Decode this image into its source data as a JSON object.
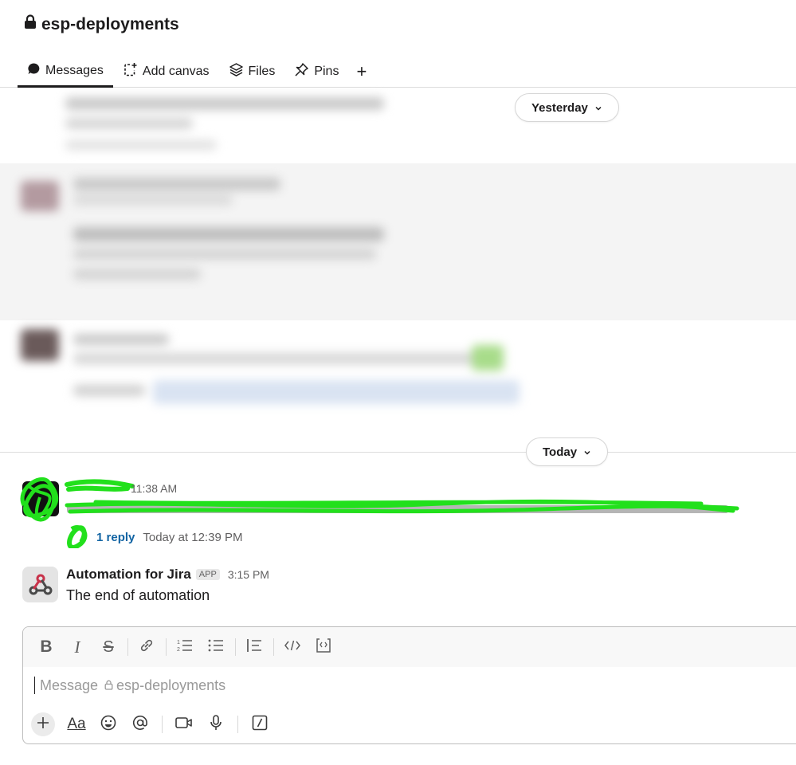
{
  "channel": {
    "name": "esp-deployments",
    "lock_icon": "lock-icon"
  },
  "tabs": [
    {
      "label": "Messages",
      "icon": "message-bubble-icon",
      "active": true
    },
    {
      "label": "Add canvas",
      "icon": "add-canvas-icon",
      "active": false
    },
    {
      "label": "Files",
      "icon": "layers-icon",
      "active": false
    },
    {
      "label": "Pins",
      "icon": "pin-icon",
      "active": false
    }
  ],
  "add_tab_label": "+",
  "date_dividers": {
    "yesterday": "Yesterday",
    "today": "Today"
  },
  "messages": {
    "first": {
      "time": "11:38 AM",
      "thread": {
        "reply_count": "1 reply",
        "last_reply": "Today at 12:39 PM"
      }
    },
    "second": {
      "author": "Automation for Jira",
      "badge": "APP",
      "time": "3:15 PM",
      "text": "The end of automation",
      "avatar_icon": "jira-automation-webhook-icon"
    }
  },
  "composer": {
    "placeholder_prefix": "Message",
    "placeholder_channel": "esp-deployments",
    "format_buttons": [
      "bold",
      "italic",
      "strikethrough",
      "link",
      "ordered-list",
      "bulleted-list",
      "blockquote",
      "code",
      "code-block"
    ],
    "bottom_buttons": [
      "plus",
      "formatting",
      "emoji",
      "mention",
      "video",
      "audio",
      "slash-command"
    ],
    "format_labels": {
      "bold": "B",
      "italic": "I",
      "strike": "S",
      "aa": "Aa"
    }
  },
  "colors": {
    "link_blue": "#1264a3",
    "redaction_green": "#22e01c",
    "text": "#1d1c1d",
    "muted": "#616061"
  }
}
